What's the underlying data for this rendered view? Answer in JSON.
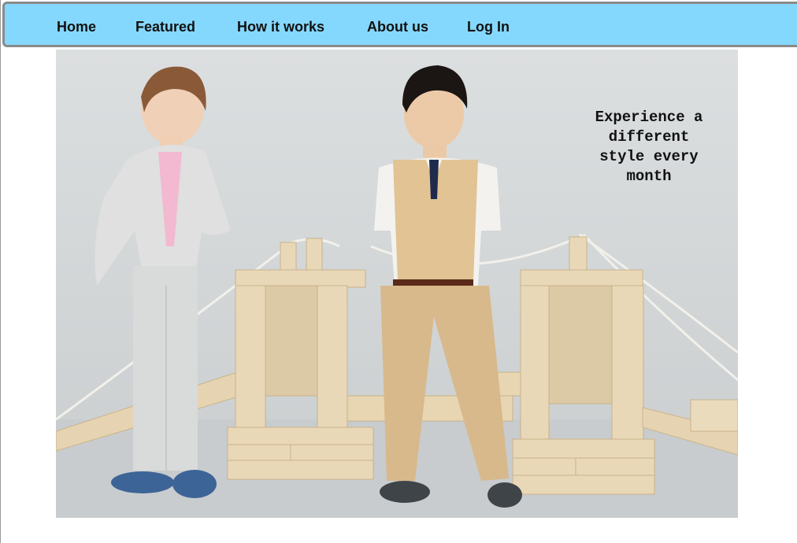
{
  "nav": {
    "items": [
      {
        "label": "Home"
      },
      {
        "label": "Featured"
      },
      {
        "label": "How it works"
      },
      {
        "label": "About us"
      },
      {
        "label": "Log In"
      }
    ]
  },
  "hero": {
    "image_alt": "Two boys in tailored outfits standing in front of a wooden block bridge",
    "tagline": "Experience a different style every month"
  },
  "colors": {
    "nav_background": "#85d8fd",
    "nav_border": "#8a8a8a",
    "text": "#111111"
  }
}
